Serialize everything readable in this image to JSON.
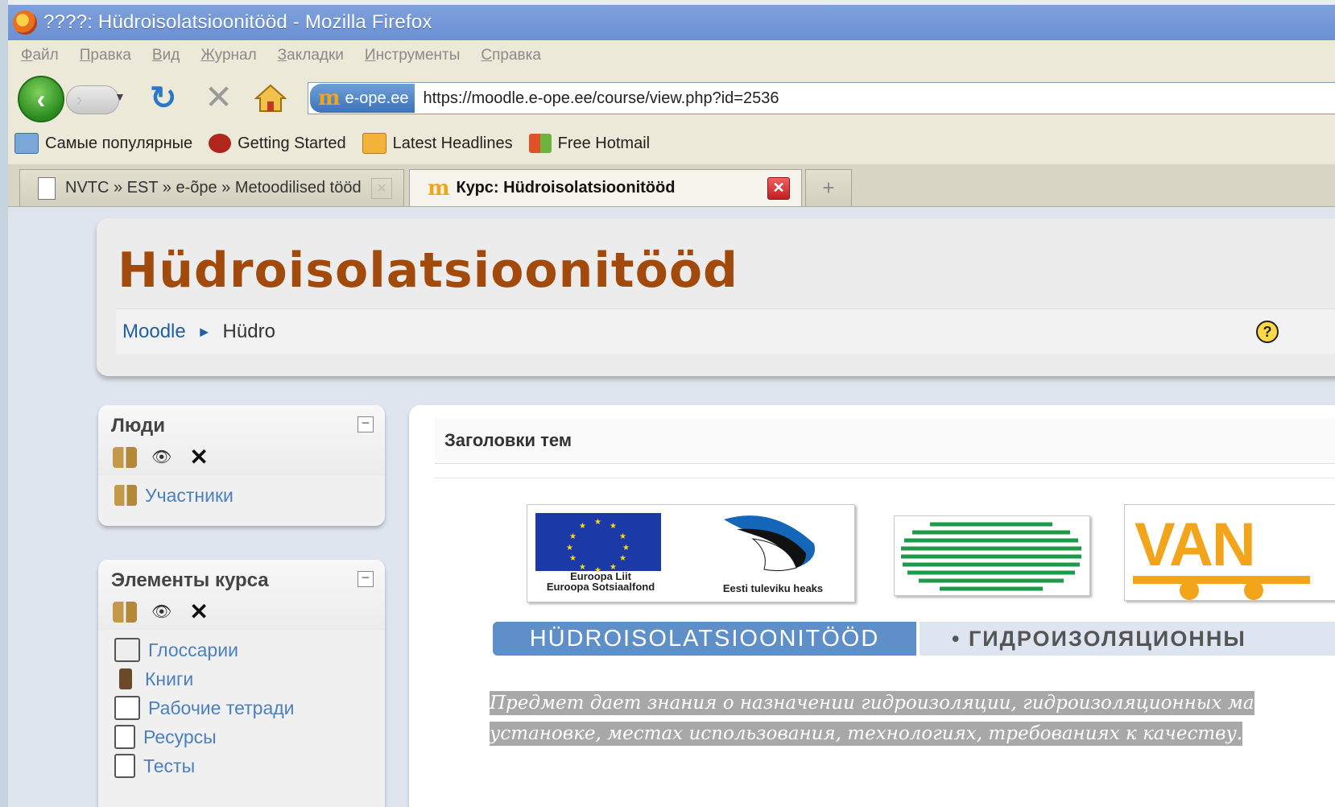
{
  "window": {
    "title": "????: Hüdroisolatsioonitööd - Mozilla Firefox"
  },
  "menu": [
    "Файл",
    "Правка",
    "Вид",
    "Журнал",
    "Закладки",
    "Инструменты",
    "Справка"
  ],
  "nav": {
    "site_badge": "e-ope.ee",
    "url": "https://moodle.e-ope.ee/course/view.php?id=2536"
  },
  "bookmarks": [
    {
      "label": "Самые популярные",
      "icon": "most-visited-icon",
      "color": "#4a7fc0"
    },
    {
      "label": "Getting Started",
      "icon": "firefox-bookmark-icon",
      "color": "#b0261c"
    },
    {
      "label": "Latest Headlines",
      "icon": "rss-feed-icon",
      "color": "#f0a020"
    },
    {
      "label": "Free Hotmail",
      "icon": "windows-icon",
      "color": "#3b8ad9"
    }
  ],
  "tabs": [
    {
      "label": "NVTC » EST » e-õpe » Metoodilised tööd",
      "active": false
    },
    {
      "label": "Курс: Hüdroisolatsioonitööd",
      "active": true
    }
  ],
  "course": {
    "title": "Hüdroisolatsioonitööd",
    "breadcrumb_root": "Moodle",
    "breadcrumb_current": "Hüdro"
  },
  "blocks": {
    "people": {
      "title": "Люди",
      "items": [
        {
          "label": "Участники",
          "icon": "participants-icon"
        }
      ]
    },
    "activities": {
      "title": "Элементы курса",
      "items": [
        {
          "label": "Глоссарии",
          "icon": "glossary-icon"
        },
        {
          "label": "Книги",
          "icon": "book-icon"
        },
        {
          "label": "Рабочие тетради",
          "icon": "workbook-icon"
        },
        {
          "label": "Ресурсы",
          "icon": "resource-icon"
        },
        {
          "label": "Тесты",
          "icon": "quiz-icon"
        }
      ]
    }
  },
  "main": {
    "topics_header": "Заголовки тем",
    "eu_caption_line1": "Euroopa Liit",
    "eu_caption_line2": "Euroopa Sotsiaalfond",
    "ee_caption": "Eesti tuleviku heaks",
    "van_logo_text": "VAN",
    "banner_est": "HÜDROISOLATSIOONITÖÖD",
    "banner_ru": "• ГИДРОИЗОЛЯЦИОННЫ",
    "description_line1": "Предмет дает знания о назначении гидроизоляции, гидроизоляционных ма",
    "description_line2": "установке, местах использования, технологиях, требованиях к качеству."
  },
  "colors": {
    "title_accent": "#a24a0c",
    "link": "#4a7fc0",
    "banner_blue": "#5e8fc8"
  }
}
